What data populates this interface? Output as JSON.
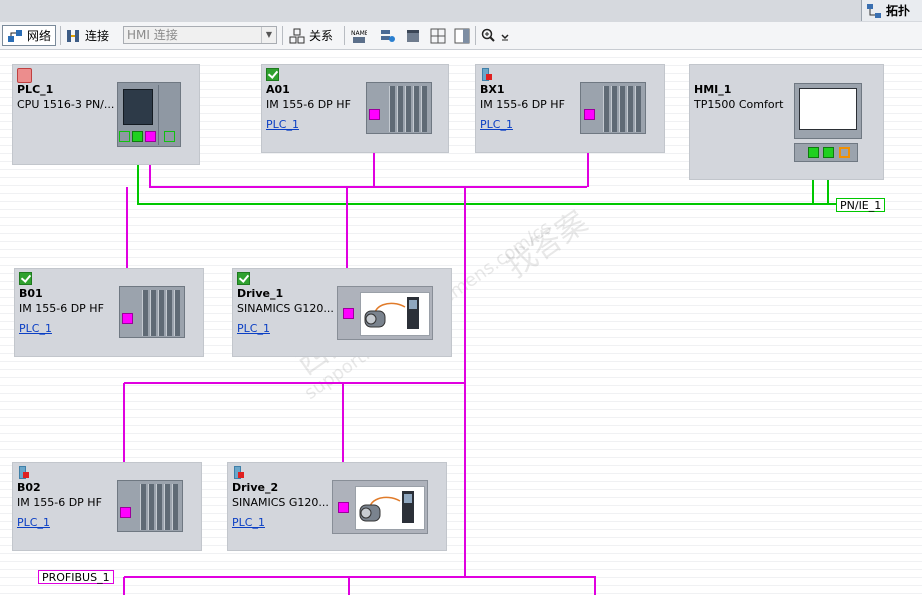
{
  "top_tab": {
    "label": "拓扑",
    "icon": "topology-view-icon"
  },
  "toolbar": {
    "network_label": "网络",
    "connections_label": "连接",
    "connection_type_value": "HMI 连接",
    "relations_label": "关系",
    "icons": [
      "network-view-icon",
      "connections-icon",
      "relations-icon",
      "show-names-icon",
      "highlight-icon",
      "page-break-icon",
      "grid-icon",
      "split-view-icon",
      "zoom-icon"
    ]
  },
  "devices": [
    {
      "key": "plc1",
      "name": "PLC_1",
      "type": "CPU 1516-3 PN/...",
      "link": "",
      "status": "plc"
    },
    {
      "key": "a01",
      "name": "A01",
      "type": "IM 155-6 DP HF",
      "link": "PLC_1",
      "status": "ok"
    },
    {
      "key": "bx1",
      "name": "BX1",
      "type": "IM 155-6 DP HF",
      "link": "PLC_1",
      "status": "error"
    },
    {
      "key": "hmi1",
      "name": "HMI_1",
      "type": "TP1500 Comfort",
      "link": "",
      "status": "none"
    },
    {
      "key": "b01",
      "name": "B01",
      "type": "IM 155-6 DP HF",
      "link": "PLC_1",
      "status": "ok"
    },
    {
      "key": "drive1",
      "name": "Drive_1",
      "type": "SINAMICS G120...",
      "link": "PLC_1",
      "status": "ok"
    },
    {
      "key": "b02",
      "name": "B02",
      "type": "IM 155-6 DP HF",
      "link": "PLC_1",
      "status": "error"
    },
    {
      "key": "drive2",
      "name": "Drive_2",
      "type": "SINAMICS G120...",
      "link": "PLC_1",
      "status": "error"
    }
  ],
  "networks": {
    "pnie": "PN/IE_1",
    "profibus": "PROFIBUS_1"
  },
  "watermark": {
    "line1": "西门子工业",
    "line2": "找答案",
    "line3": "support.industry.siemens.com/cs"
  },
  "colors": {
    "profinet": "#00c800",
    "profibus": "#e000e0",
    "device_bg": "#d3d6dc"
  }
}
